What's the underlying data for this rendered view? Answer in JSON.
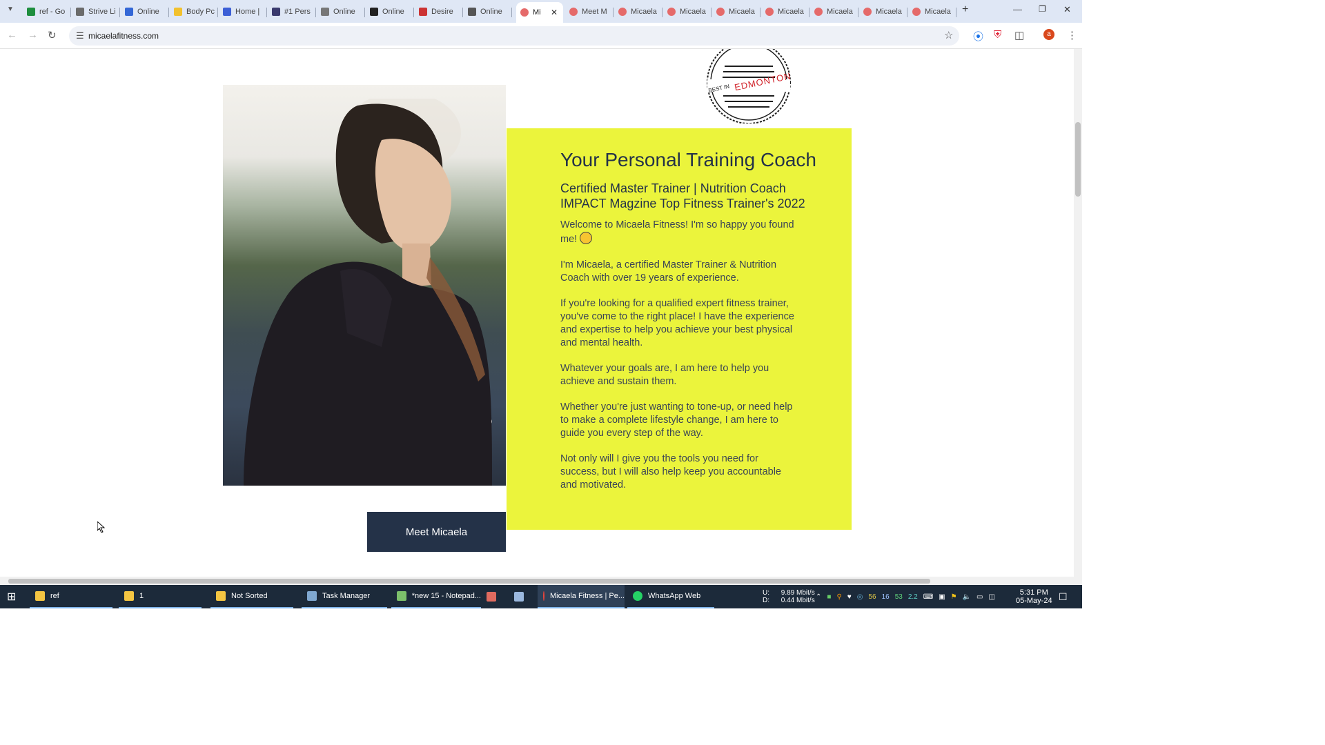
{
  "browser": {
    "tabs": [
      {
        "label": "ref - Go",
        "favicon": "sheets-icon",
        "color": "#1e8e3e"
      },
      {
        "label": "Strive Li",
        "favicon": "shield-icon",
        "color": "#6b6b6b"
      },
      {
        "label": "Online",
        "favicon": "check-icon",
        "color": "#3367d6"
      },
      {
        "label": "Body Pc",
        "favicon": "moon-icon",
        "color": "#f2c12e"
      },
      {
        "label": "Home |",
        "favicon": "stack-icon",
        "color": "#3c5fd6"
      },
      {
        "label": "#1 Pers",
        "favicon": "hex-icon",
        "color": "#3a3a6e"
      },
      {
        "label": "Online",
        "favicon": "circle-icon",
        "color": "#777"
      },
      {
        "label": "Online",
        "favicon": "mountain-icon",
        "color": "#222"
      },
      {
        "label": "Desire",
        "favicon": "refresh-icon",
        "color": "#c33"
      },
      {
        "label": "Online",
        "favicon": "runner-icon",
        "color": "#555"
      },
      {
        "label": "Mi",
        "favicon": "micaela-icon",
        "color": "#e56a6a",
        "active": true
      },
      {
        "label": "Meet M",
        "favicon": "micaela-icon",
        "color": "#e56a6a"
      },
      {
        "label": "Micaela",
        "favicon": "micaela-icon",
        "color": "#e56a6a"
      },
      {
        "label": "Micaela",
        "favicon": "micaela-icon",
        "color": "#e56a6a"
      },
      {
        "label": "Micaela",
        "favicon": "micaela-icon",
        "color": "#e56a6a"
      },
      {
        "label": "Micaela",
        "favicon": "micaela-icon",
        "color": "#e56a6a"
      },
      {
        "label": "Micaela",
        "favicon": "micaela-icon",
        "color": "#e56a6a"
      },
      {
        "label": "Micaela",
        "favicon": "micaela-icon",
        "color": "#e56a6a"
      },
      {
        "label": "Micaela",
        "favicon": "micaela-icon",
        "color": "#e56a6a"
      }
    ],
    "url": "micaelafitness.com",
    "profile_initial": "a"
  },
  "page": {
    "badge": {
      "text_small": "BEST IN",
      "text_big": "EDMONTON"
    },
    "card": {
      "title": "Your Personal Training Coach",
      "subtitle_1": "Certified Master Trainer | Nutrition Coach",
      "subtitle_2": "IMPACT Magzine Top Fitness Trainer's 2022",
      "para_1": "Welcome to Micaela Fitness! I'm so happy you found me!",
      "para_2": "I'm Micaela, a certified Master Trainer & Nutrition Coach with over 19 years of experience.",
      "para_3": "If you're looking for a qualified expert fitness trainer, you've come to the right place! I have the experience and expertise to help you achieve your best physical and mental health.",
      "para_4": "Whatever your goals are, I am here to help you achieve and sustain them.",
      "para_5": "Whether you're just wanting to tone-up, or need help to make a complete lifestyle change, I am here to guide you every step of the way.",
      "para_6": "Not only will I give you the tools you need for success, but I will also help keep you accountable and motivated.",
      "bg_color": "#ebf43c",
      "text_color": "#243248"
    },
    "cta_label": "Meet Micaela"
  },
  "taskbar": {
    "items": [
      {
        "label": "ref",
        "icon": "folder-icon"
      },
      {
        "label": "1",
        "icon": "folder-icon"
      },
      {
        "label": "Not Sorted",
        "icon": "folder-icon"
      },
      {
        "label": "Task Manager",
        "icon": "task-manager-icon"
      },
      {
        "label": "*new 15 - Notepad...",
        "icon": "notepad-icon"
      },
      {
        "label": "Micaela Fitness | Pe...",
        "icon": "chrome-icon"
      },
      {
        "label": "WhatsApp Web",
        "icon": "whatsapp-icon"
      }
    ],
    "net_up_label": "U:",
    "net_down_label": "D:",
    "net_up": "9.89 Mbit/s",
    "net_down": "0.44 Mbit/s",
    "tray_nums": [
      "56",
      "16",
      "53",
      "2.2"
    ],
    "time": "5:31 PM",
    "date": "05-May-24"
  }
}
